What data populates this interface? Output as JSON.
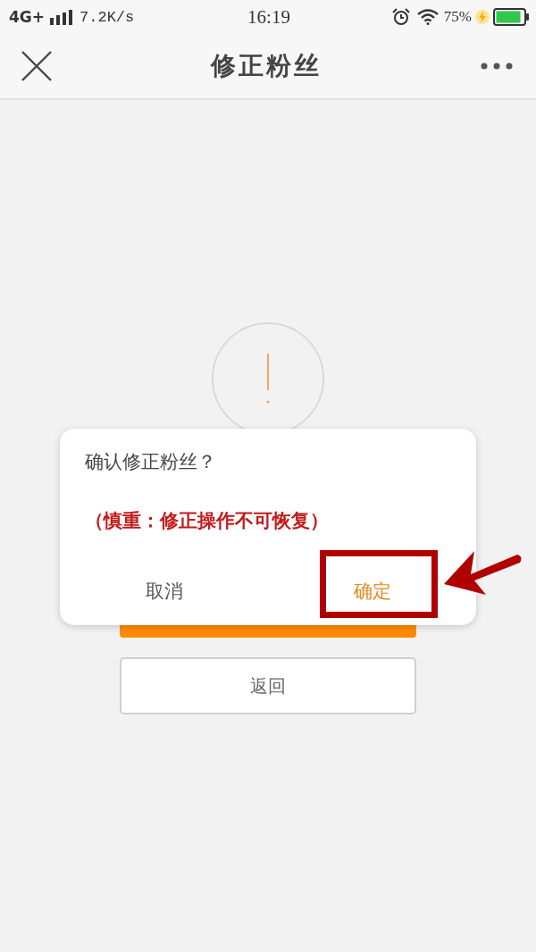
{
  "status_bar": {
    "network": "4G+",
    "speed": "7.2K/s",
    "time": "16:19",
    "battery": "75%"
  },
  "nav_bar": {
    "title": "修正粉丝"
  },
  "dialog": {
    "title": "确认修正粉丝？",
    "warning": "（慎重：修正操作不可恢复）",
    "buttons": [
      {
        "label": "取消",
        "kind": "cancel",
        "highlighted": false
      },
      {
        "label": "确定",
        "kind": "confirm",
        "highlighted": true
      }
    ]
  },
  "back_button": {
    "label": "返回"
  }
}
